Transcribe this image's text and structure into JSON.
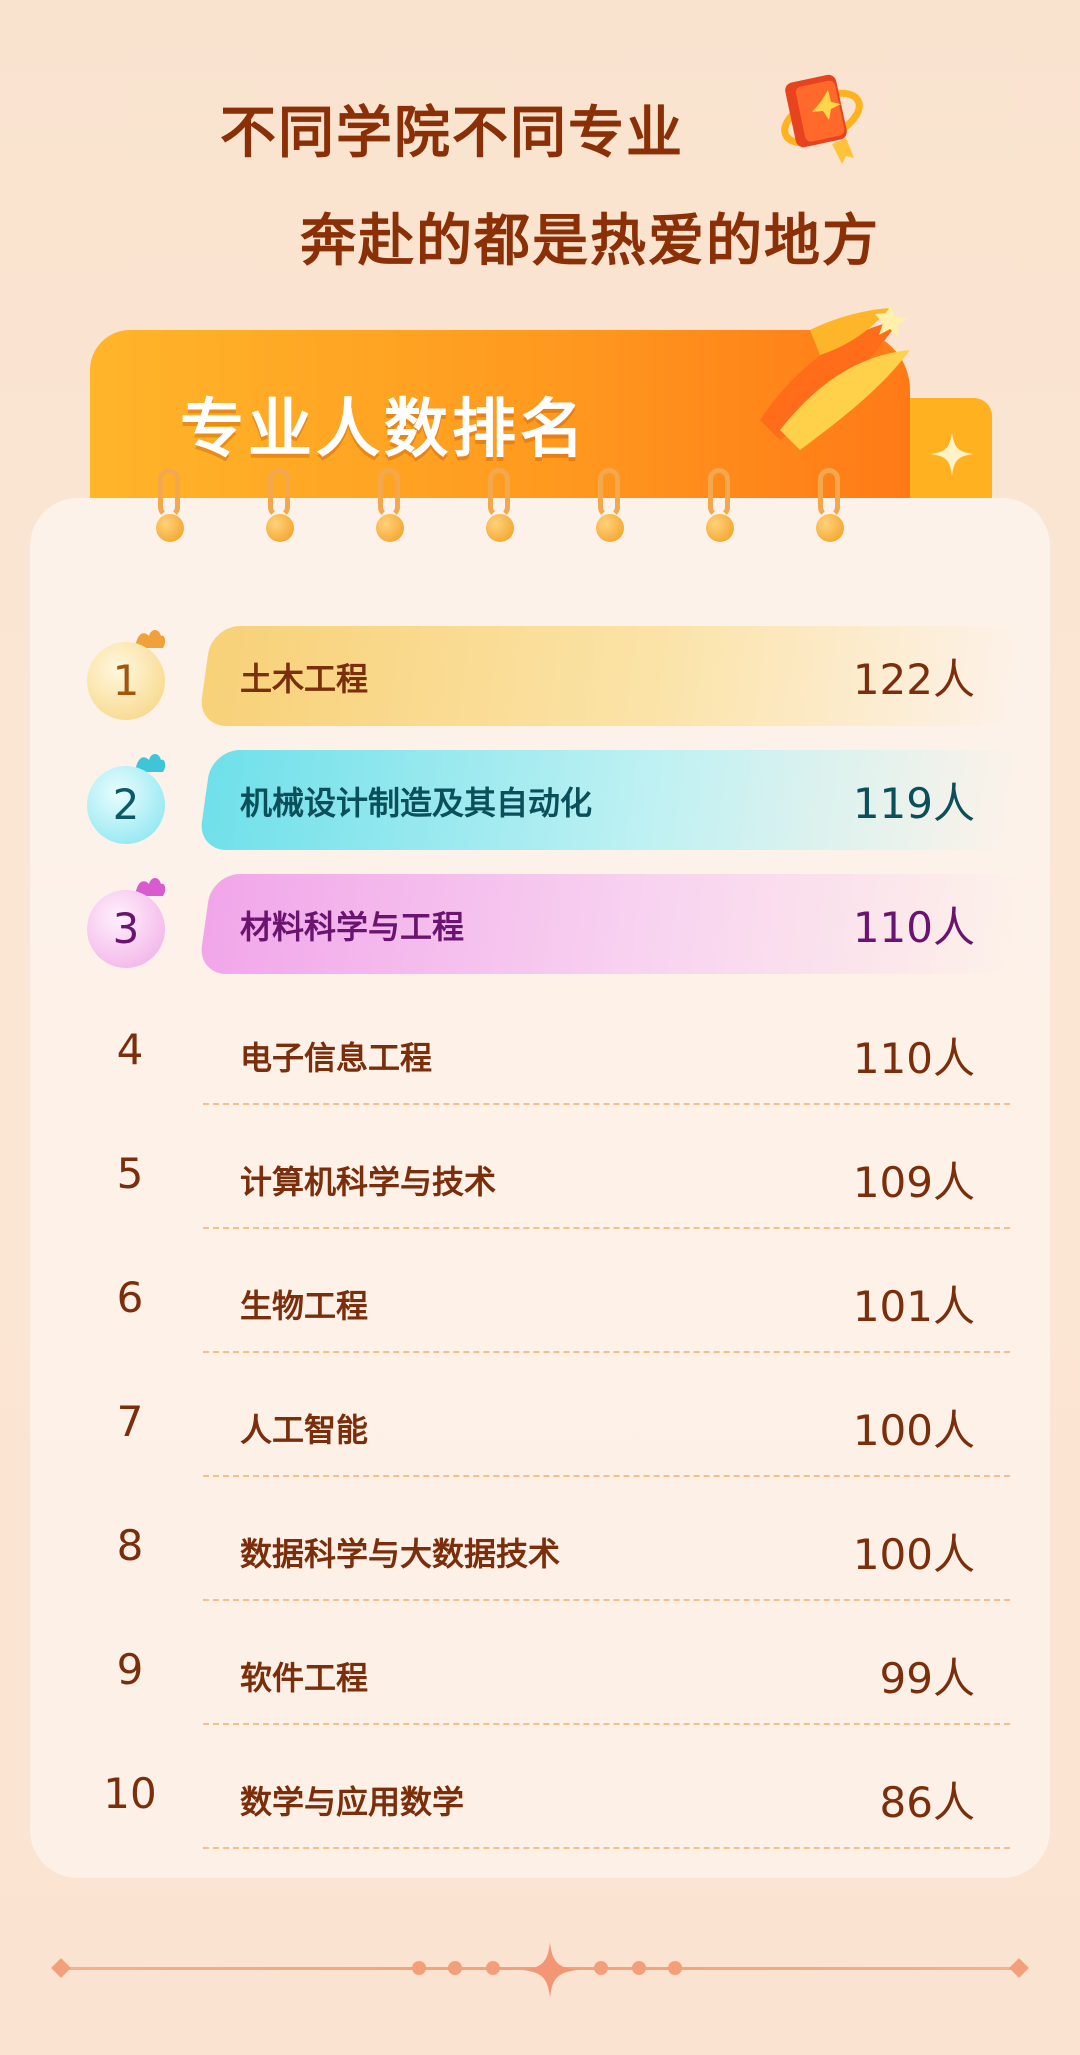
{
  "headline": {
    "line1": "不同学院不同专业",
    "line2": "奔赴的都是热爱的地方"
  },
  "section": {
    "title": "专业人数排名"
  },
  "ranking": [
    {
      "rank": "1",
      "name": "土木工程",
      "count": "122人"
    },
    {
      "rank": "2",
      "name": "机械设计制造及其自动化",
      "count": "119人"
    },
    {
      "rank": "3",
      "name": "材料科学与工程",
      "count": "110人"
    },
    {
      "rank": "4",
      "name": "电子信息工程",
      "count": "110人"
    },
    {
      "rank": "5",
      "name": "计算机科学与技术",
      "count": "109人"
    },
    {
      "rank": "6",
      "name": "生物工程",
      "count": "101人"
    },
    {
      "rank": "7",
      "name": "人工智能",
      "count": "100人"
    },
    {
      "rank": "8",
      "name": "数据科学与大数据技术",
      "count": "100人"
    },
    {
      "rank": "9",
      "name": "软件工程",
      "count": "99人"
    },
    {
      "rank": "10",
      "name": "数学与应用数学",
      "count": "86人"
    }
  ],
  "colors": {
    "gold": "#f6d27a",
    "cyan": "#6fe0ea",
    "pink": "#f1a6e8",
    "brown_text": "#7a2e0b",
    "orange": "#ff9a1f"
  },
  "icons": {
    "book": "book-icon",
    "sparkle": "sparkle-icon",
    "medal": "medal-icon"
  }
}
